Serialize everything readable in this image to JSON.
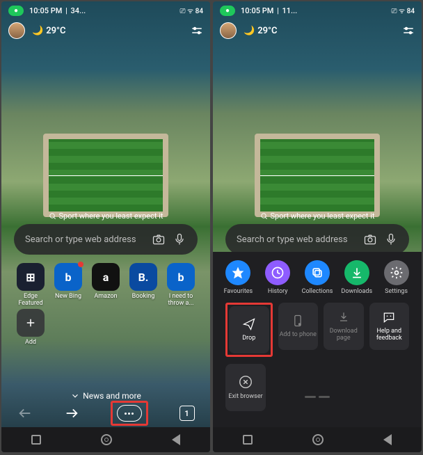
{
  "status": {
    "time": "10:05 PM",
    "leftExtraA": "34...",
    "leftExtraB": "11...",
    "iconsRight": "⎚ ᯤ 84"
  },
  "weather": {
    "temp": "29°C"
  },
  "promo": "Sport where you least expect it",
  "search": {
    "placeholder": "Search or type web address"
  },
  "tiles": [
    {
      "label": "Edge Featured",
      "bg": "#1a2030",
      "glyph": "⊞"
    },
    {
      "label": "New Bing",
      "bg": "#0a63c9",
      "glyph": "b",
      "dot": true
    },
    {
      "label": "Amazon",
      "bg": "#111",
      "glyph": "a"
    },
    {
      "label": "Booking",
      "bg": "#0a4aa0",
      "glyph": "B."
    },
    {
      "label": "I need to throw a...",
      "bg": "#0a63c9",
      "glyph": "b"
    }
  ],
  "addTile": {
    "label": "Add"
  },
  "newsMore": "News and more",
  "tabCount": "1",
  "panel": {
    "row1": [
      {
        "label": "Favourites",
        "bg": "#1e88ff",
        "icon": "star"
      },
      {
        "label": "History",
        "bg": "#8e5cff",
        "icon": "clock"
      },
      {
        "label": "Collections",
        "bg": "#1e88ff",
        "icon": "copy"
      },
      {
        "label": "Downloads",
        "bg": "#16b86a",
        "icon": "down"
      },
      {
        "label": "Settings",
        "bg": "#6b6b70",
        "icon": "gear"
      }
    ],
    "row2": [
      {
        "label": "Drop",
        "active": true,
        "highlight": true,
        "icon": "send"
      },
      {
        "label": "Add to phone",
        "active": false,
        "icon": "phone"
      },
      {
        "label": "Download page",
        "active": false,
        "icon": "dl"
      },
      {
        "label": "Help and feedback",
        "active": true,
        "icon": "chat"
      }
    ],
    "exit": {
      "label": "Exit browser"
    }
  }
}
